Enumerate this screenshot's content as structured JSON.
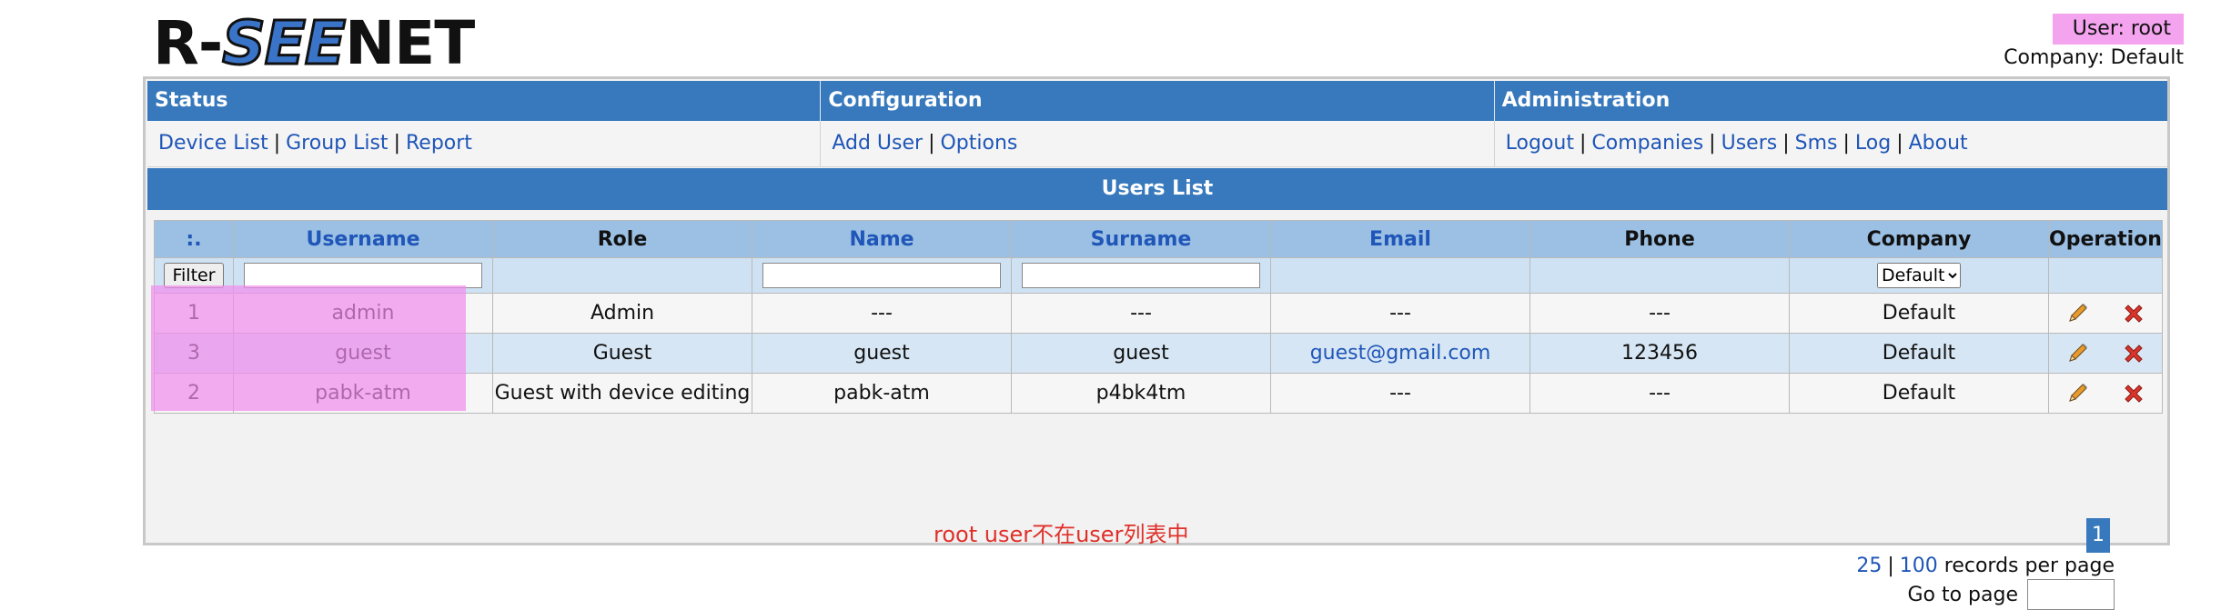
{
  "logo": {
    "left": "R-",
    "mid": "SEE",
    "right": "NET"
  },
  "header": {
    "user": "User: root",
    "company": "Company: Default"
  },
  "menu": {
    "status": {
      "title": "Status",
      "links": [
        "Device List",
        "Group List",
        "Report"
      ]
    },
    "configuration": {
      "title": "Configuration",
      "links": [
        "Add User",
        "Options"
      ]
    },
    "administration": {
      "title": "Administration",
      "links": [
        "Logout",
        "Companies",
        "Users",
        "Sms",
        "Log",
        "About"
      ]
    }
  },
  "list_title": "Users List",
  "table": {
    "columns": [
      ":.",
      "Username",
      "Role",
      "Name",
      "Surname",
      "Email",
      "Phone",
      "Company",
      "Operation"
    ],
    "filter_button": "Filter",
    "company_filter": "Default",
    "rows": [
      {
        "id": "1",
        "username": "admin",
        "role": "Admin",
        "name": "---",
        "surname": "---",
        "email": "---",
        "phone": "---",
        "company": "Default"
      },
      {
        "id": "3",
        "username": "guest",
        "role": "Guest",
        "name": "guest",
        "surname": "guest",
        "email": "guest@gmail.com",
        "phone": "123456",
        "company": "Default"
      },
      {
        "id": "2",
        "username": "pabk-atm",
        "role": "Guest with device editing",
        "name": "pabk-atm",
        "surname": "p4bk4tm",
        "email": "---",
        "phone": "---",
        "company": "Default"
      }
    ]
  },
  "note": "root user不在user列表中",
  "pagination": {
    "current_page": "1",
    "per_page_25": "25",
    "per_page_100": "100",
    "records_per_page": "records per page",
    "go_to_page": "Go to page"
  },
  "colors": {
    "header_blue": "#3779bc",
    "highlight_pink": "#f4a4ee",
    "link_blue": "#1f56b8",
    "note_red": "#e0302a"
  }
}
